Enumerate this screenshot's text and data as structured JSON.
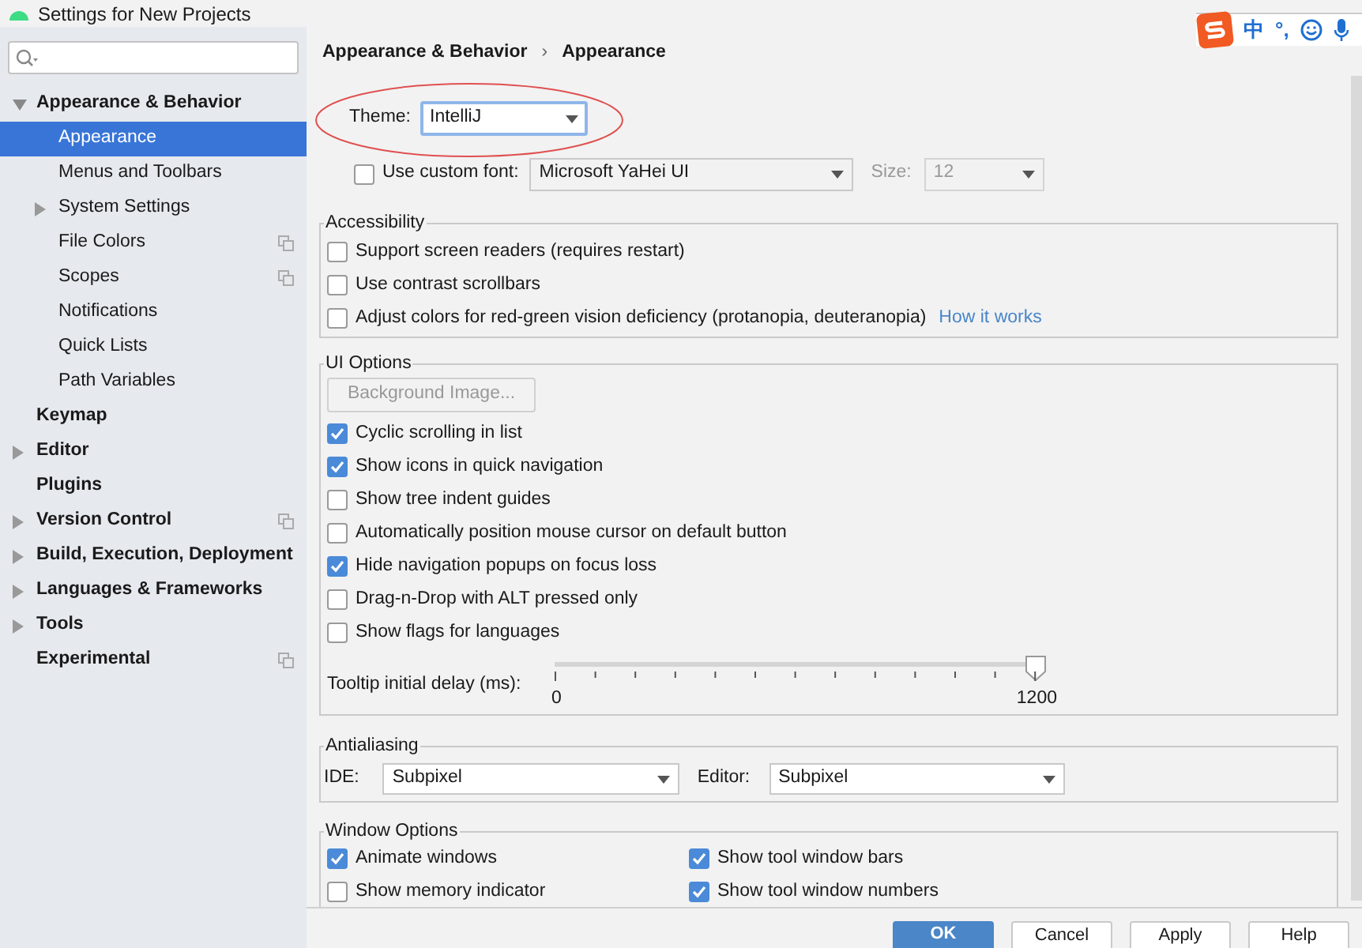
{
  "window": {
    "title": "Settings for New Projects"
  },
  "ime_toolbar": {
    "items": [
      {
        "kind": "text",
        "label": "中"
      },
      {
        "kind": "text",
        "label": "°,"
      },
      {
        "kind": "smiley"
      },
      {
        "kind": "mic"
      }
    ]
  },
  "sidebar": {
    "items": [
      {
        "label": "Appearance & Behavior",
        "bold": true,
        "expanded": true,
        "selected": false,
        "children": [
          {
            "label": "Appearance",
            "selected": true
          },
          {
            "label": "Menus and Toolbars",
            "selected": false
          },
          {
            "label": "System Settings",
            "selected": false,
            "expandable": true
          },
          {
            "label": "File Colors",
            "selected": false,
            "project_icon": true
          },
          {
            "label": "Scopes",
            "selected": false,
            "project_icon": true
          },
          {
            "label": "Notifications",
            "selected": false
          },
          {
            "label": "Quick Lists",
            "selected": false
          },
          {
            "label": "Path Variables",
            "selected": false
          }
        ]
      },
      {
        "label": "Keymap",
        "bold": true,
        "selected": false
      },
      {
        "label": "Editor",
        "bold": true,
        "selected": false,
        "expandable": true
      },
      {
        "label": "Plugins",
        "bold": true,
        "selected": false
      },
      {
        "label": "Version Control",
        "bold": true,
        "selected": false,
        "expandable": true,
        "project_icon": true
      },
      {
        "label": "Build, Execution, Deployment",
        "bold": true,
        "selected": false,
        "expandable": true
      },
      {
        "label": "Languages & Frameworks",
        "bold": true,
        "selected": false,
        "expandable": true
      },
      {
        "label": "Tools",
        "bold": true,
        "selected": false,
        "expandable": true
      },
      {
        "label": "Experimental",
        "bold": true,
        "selected": false,
        "project_icon": true
      }
    ]
  },
  "breadcrumb": [
    "Appearance & Behavior",
    "›",
    "Appearance"
  ],
  "theme": {
    "label": "Theme:",
    "value": "IntelliJ"
  },
  "custom_font": {
    "label": "Use custom font:",
    "checked": false,
    "font": "Microsoft YaHei UI",
    "size_label": "Size:",
    "size": "12"
  },
  "accessibility": {
    "title": "Accessibility",
    "options": [
      {
        "label": "Support screen readers (requires restart)",
        "checked": false
      },
      {
        "label": "Use contrast scrollbars",
        "checked": false
      },
      {
        "label": "Adjust colors for red-green vision deficiency (protanopia, deuteranopia)",
        "checked": false,
        "link": "How it works"
      }
    ]
  },
  "ui_options": {
    "title": "UI Options",
    "background_button": "Background Image...",
    "options": [
      {
        "label": "Cyclic scrolling in list",
        "checked": true
      },
      {
        "label": "Show icons in quick navigation",
        "checked": true
      },
      {
        "label": "Show tree indent guides",
        "checked": false
      },
      {
        "label": "Automatically position mouse cursor on default button",
        "checked": false
      },
      {
        "label": "Hide navigation popups on focus loss",
        "checked": true
      },
      {
        "label": "Drag-n-Drop with ALT pressed only",
        "checked": false
      },
      {
        "label": "Show flags for languages",
        "checked": false
      }
    ],
    "tooltip_delay": {
      "label": "Tooltip initial delay (ms):",
      "level": 1,
      "min_label": "0",
      "max_label": "1200"
    }
  },
  "antialiasing": {
    "title": "Antialiasing",
    "ide_label": "IDE:",
    "ide_value": "Subpixel",
    "editor_label": "Editor:",
    "editor_value": "Subpixel"
  },
  "window_options": {
    "title": "Window Options",
    "options": [
      {
        "label": "Animate windows",
        "checked": true
      },
      {
        "label": "Show tool window bars",
        "checked": true
      },
      {
        "label": "Show memory indicator",
        "checked": false
      },
      {
        "label": "Show tool window numbers",
        "checked": true
      }
    ]
  },
  "buttons": [
    {
      "label": "OK",
      "default": true
    },
    {
      "label": "Cancel",
      "default": false
    },
    {
      "label": "Apply",
      "default": false
    },
    {
      "label": "Help",
      "default": false
    }
  ]
}
